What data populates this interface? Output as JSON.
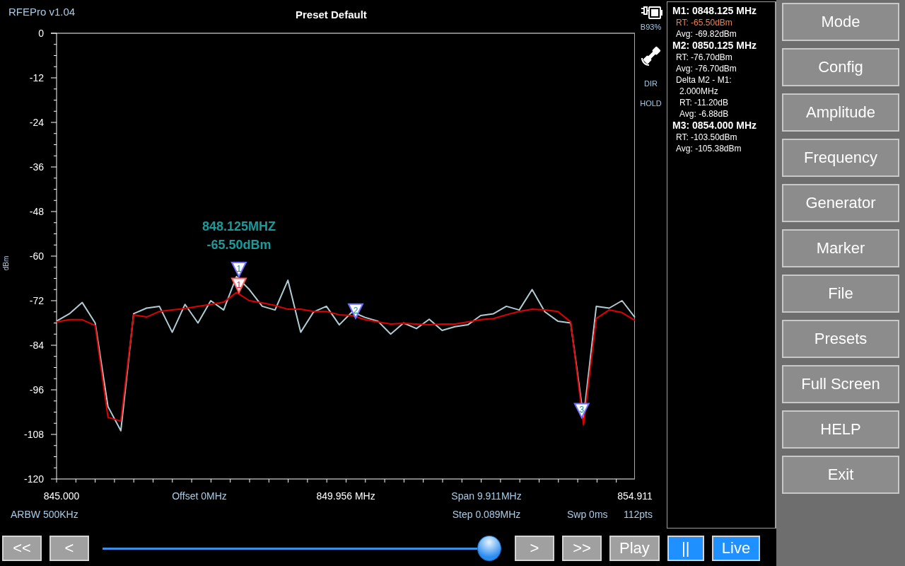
{
  "header": {
    "app_version": "RFEPro v1.04",
    "title": "Preset Default"
  },
  "spectrum": {
    "chart_data": {
      "type": "line",
      "ylabel": "dBm",
      "xlim": [
        845,
        854.911
      ],
      "ylim": [
        -120,
        0
      ],
      "yticks": [
        0,
        -12,
        -24,
        -36,
        -48,
        -60,
        -72,
        -84,
        -96,
        -108,
        -120
      ],
      "xticks": [
        {
          "value": 845,
          "label": "845.000"
        },
        {
          "value": 849.956,
          "label": "849.956 MHz"
        },
        {
          "value": 854.911,
          "label": "854.911"
        }
      ],
      "x": [
        845.0,
        845.22,
        845.44,
        845.661,
        845.881,
        846.101,
        846.321,
        846.542,
        846.762,
        846.982,
        847.202,
        847.423,
        847.643,
        847.863,
        848.083,
        848.304,
        848.524,
        848.744,
        848.964,
        849.184,
        849.405,
        849.625,
        849.845,
        850.065,
        850.286,
        850.506,
        850.726,
        850.946,
        851.167,
        851.387,
        851.607,
        851.827,
        852.048,
        852.268,
        852.488,
        852.708,
        852.929,
        853.149,
        853.369,
        853.589,
        853.81,
        854.03,
        854.25,
        854.47,
        854.691,
        854.911
      ],
      "series": [
        {
          "color": "#b0ccd4",
          "values": [
            -77.5,
            -75.5,
            -72.5,
            -78.0,
            -100.5,
            -107.0,
            -75.5,
            -74.0,
            -73.5,
            -80.5,
            -73.0,
            -78.0,
            -72.0,
            -74.5,
            -65.5,
            -69.0,
            -73.5,
            -74.5,
            -66.5,
            -80.5,
            -75.0,
            -73.5,
            -78.5,
            -75.0,
            -76.5,
            -77.5,
            -81.0,
            -78.0,
            -79.5,
            -77.0,
            -80.0,
            -79.0,
            -78.5,
            -76.0,
            -75.5,
            -73.5,
            -74.5,
            -69.0,
            -75.0,
            -77.5,
            -78.0,
            -103.5,
            -73.5,
            -74.0,
            -72.0,
            -76.5
          ]
        },
        {
          "color": "#e00000",
          "values": [
            -77.7,
            -77.1,
            -77.1,
            -78.7,
            -103.4,
            -104.4,
            -75.8,
            -76.4,
            -74.9,
            -74.5,
            -74.1,
            -73.5,
            -73.0,
            -72.4,
            -69.8,
            -72.0,
            -72.6,
            -73.3,
            -74.3,
            -74.3,
            -74.9,
            -74.9,
            -75.8,
            -76.0,
            -77.1,
            -77.7,
            -78.3,
            -78.1,
            -78.3,
            -78.5,
            -78.3,
            -78.3,
            -77.7,
            -77.1,
            -76.8,
            -75.8,
            -74.9,
            -74.3,
            -74.5,
            -74.9,
            -77.7,
            -105.4,
            -76.8,
            -74.5,
            -75.2,
            -77.3
          ]
        }
      ],
      "annotations": [
        {
          "text": "1",
          "x": 848.125,
          "y": -69.82
        },
        {
          "text": "1",
          "x": 848.125,
          "y": -65.5
        },
        {
          "text": "2",
          "x": 850.125,
          "y": -76.7
        },
        {
          "text": "3",
          "x": 854.0,
          "y": -103.5
        }
      ]
    },
    "marker_readout": {
      "frequency": "848.125MHZ",
      "level": "-65.50dBm"
    },
    "scan_info": {
      "offset": "Offset 0MHz",
      "span": "Span 9.911MHz",
      "rbw": "ARBW 500KHz",
      "step": "Step 0.089MHz",
      "sweep": "Swp 0ms",
      "points": "112pts"
    }
  },
  "status_icons": {
    "battery": "B93%",
    "modes": [
      "DIR",
      "HOLD"
    ]
  },
  "marker_panel": {
    "lines": [
      {
        "kind": "heading",
        "text": "M1: 0848.125 MHz",
        "highlight": false
      },
      {
        "kind": "reading",
        "text": "RT: -65.50dBm",
        "highlight": true
      },
      {
        "kind": "reading",
        "text": "Avg: -69.82dBm",
        "highlight": false
      },
      {
        "kind": "heading",
        "text": "M2: 0850.125 MHz",
        "highlight": false
      },
      {
        "kind": "reading",
        "text": "RT: -76.70dBm",
        "highlight": false
      },
      {
        "kind": "reading",
        "text": "Avg: -76.70dBm",
        "highlight": false
      },
      {
        "kind": "reading",
        "text": "Delta M2 - M1:",
        "highlight": false
      },
      {
        "kind": "sub",
        "text": "2.000MHz",
        "highlight": false
      },
      {
        "kind": "sub",
        "text": "RT: -11.20dB",
        "highlight": false
      },
      {
        "kind": "sub",
        "text": "Avg: -6.88dB",
        "highlight": false
      },
      {
        "kind": "heading",
        "text": "M3: 0854.000 MHz",
        "highlight": false
      },
      {
        "kind": "reading",
        "text": "RT: -103.50dBm",
        "highlight": false
      },
      {
        "kind": "reading",
        "text": "Avg: -105.38dBm",
        "highlight": false
      }
    ]
  },
  "menu": [
    "Mode",
    "Config",
    "Amplitude",
    "Frequency",
    "Generator",
    "Marker",
    "File",
    "Presets",
    "Full Screen",
    "HELP",
    "Exit"
  ],
  "playback_bar": [
    {
      "kind": "button",
      "label": "<<",
      "active": false
    },
    {
      "kind": "button",
      "label": "<",
      "active": false
    },
    {
      "kind": "slider",
      "level": 0.97
    },
    {
      "kind": "button",
      "label": ">",
      "active": false
    },
    {
      "kind": "button",
      "label": ">>",
      "active": false
    },
    {
      "kind": "button",
      "label": "Play",
      "active": false
    },
    {
      "kind": "button",
      "label": "||",
      "active": true
    },
    {
      "kind": "button",
      "label": "Live",
      "active": true
    }
  ]
}
